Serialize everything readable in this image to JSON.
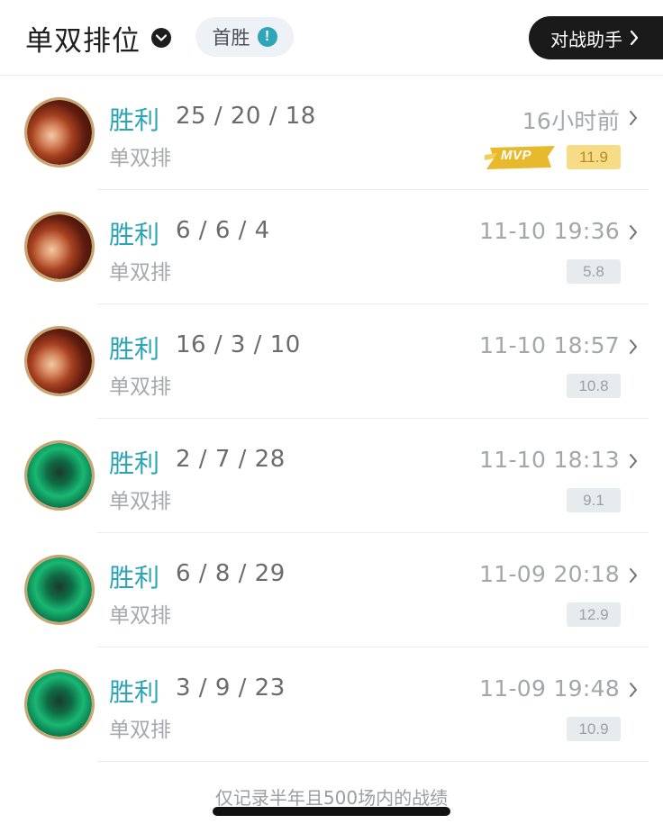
{
  "header": {
    "queue_title": "单双排位",
    "first_win_label": "首胜",
    "first_win_info": "!",
    "assistant_label": "对战助手"
  },
  "matches": [
    {
      "result": "胜利",
      "kda": "25 / 20 / 18",
      "queue": "单双排",
      "time": "16小时前",
      "score": "11.9",
      "mvp": true,
      "mvp_label": "MVP",
      "champion": "red-haired champion"
    },
    {
      "result": "胜利",
      "kda": "6 / 6 / 4",
      "queue": "单双排",
      "time": "11-10 19:36",
      "score": "5.8",
      "mvp": false,
      "champion": "red-haired champion"
    },
    {
      "result": "胜利",
      "kda": "16 / 3 / 10",
      "queue": "单双排",
      "time": "11-10 18:57",
      "score": "10.8",
      "mvp": false,
      "champion": "red-haired champion"
    },
    {
      "result": "胜利",
      "kda": "2 / 7 / 28",
      "queue": "单双排",
      "time": "11-10 18:13",
      "score": "9.1",
      "mvp": false,
      "champion": "green champion"
    },
    {
      "result": "胜利",
      "kda": "6 / 8 / 29",
      "queue": "单双排",
      "time": "11-09 20:18",
      "score": "12.9",
      "mvp": false,
      "champion": "green champion"
    },
    {
      "result": "胜利",
      "kda": "3 / 9 / 23",
      "queue": "单双排",
      "time": "11-09 19:48",
      "score": "10.9",
      "mvp": false,
      "champion": "green champion"
    }
  ],
  "footer": {
    "note": "仅记录半年且500场内的战绩"
  },
  "colors": {
    "win": "#2aa5b8",
    "mvp_gold": "#f6dc87",
    "avatar_ring": "#c9a470"
  }
}
